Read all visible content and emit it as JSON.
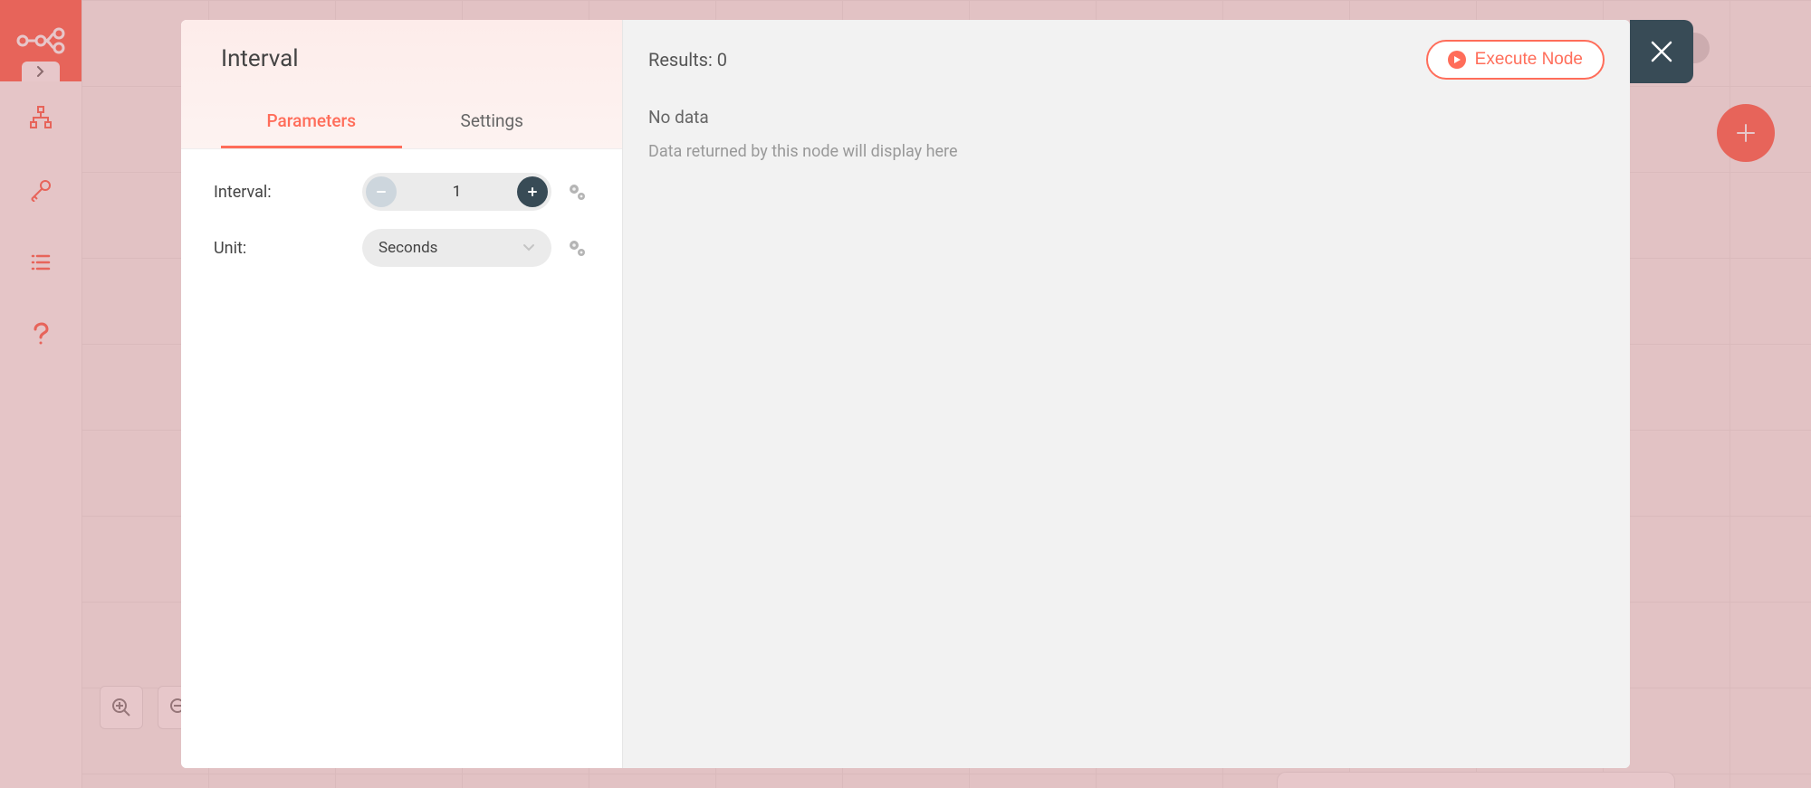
{
  "sidebar": {
    "expand_label": "›"
  },
  "modal": {
    "title": "Interval",
    "tabs": {
      "parameters": "Parameters",
      "settings": "Settings"
    },
    "params": {
      "interval_label": "Interval:",
      "interval_value": "1",
      "unit_label": "Unit:",
      "unit_value": "Seconds"
    },
    "results": {
      "header": "Results: 0",
      "exec_label": "Execute Node",
      "empty_title": "No data",
      "empty_sub": "Data returned by this node will display here"
    }
  }
}
